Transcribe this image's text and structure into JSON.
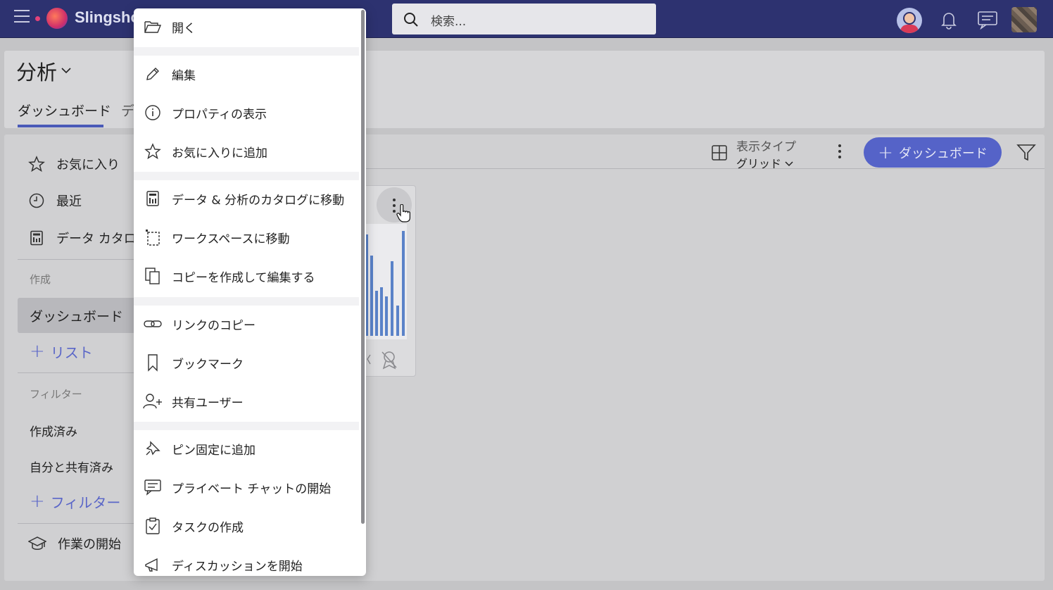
{
  "topbar": {
    "app_name": "Slingshot",
    "search_placeholder": "検索...",
    "colors": {
      "bar": "#2d3270",
      "accent": "#5563c8",
      "notification_dot": "#e3427a"
    }
  },
  "header": {
    "title": "分析",
    "tabs": [
      {
        "label": "ダッシュボード",
        "selected": true
      },
      {
        "label": "デ",
        "selected": false
      }
    ]
  },
  "sidebar": {
    "items": [
      {
        "label": "お気に入り",
        "icon": "star-icon"
      },
      {
        "label": "最近",
        "icon": "clock-icon"
      },
      {
        "label": "データ カタログ",
        "icon": "catalog-icon"
      }
    ],
    "create_label": "作成",
    "selected_item": "ダッシュボード",
    "add_list": "リスト",
    "filter_label": "フィルター",
    "filters": [
      "作成済み",
      "自分と共有済み"
    ],
    "add_filter": "フィルター",
    "getting_started": "作業の開始"
  },
  "toolbar": {
    "view_type_label": "表示タイプ",
    "view_type_value": "グリッド",
    "new_button": "ダッシュボード"
  },
  "context_menu": {
    "items": [
      {
        "label": "開く",
        "icon": "folder-open-icon"
      },
      {
        "label": "編集",
        "icon": "pencil-icon"
      },
      {
        "label": "プロパティの表示",
        "icon": "info-icon"
      },
      {
        "label": "お気に入りに追加",
        "icon": "star-icon"
      },
      {
        "label": "データ & 分析のカタログに移動",
        "icon": "catalog-icon"
      },
      {
        "label": "ワークスペースに移動",
        "icon": "workspace-icon"
      },
      {
        "label": "コピーを作成して編集する",
        "icon": "copy-icon"
      },
      {
        "label": "リンクのコピー",
        "icon": "link-icon"
      },
      {
        "label": "ブックマーク",
        "icon": "bookmark-icon"
      },
      {
        "label": "共有ユーザー",
        "icon": "add-user-icon"
      },
      {
        "label": "ピン固定に追加",
        "icon": "pin-icon"
      },
      {
        "label": "プライベート チャットの開始",
        "icon": "chat-icon"
      },
      {
        "label": "タスクの作成",
        "icon": "task-icon"
      },
      {
        "label": "ディスカッションを開始",
        "icon": "megaphone-icon"
      }
    ]
  }
}
